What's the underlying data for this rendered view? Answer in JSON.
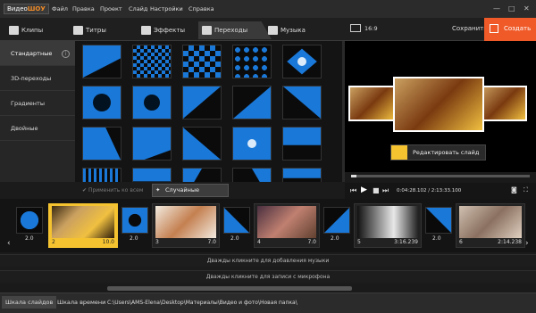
{
  "app": {
    "logo_prefix": "Видео",
    "logo_suffix": "ШОУ"
  },
  "menu": [
    "Файл",
    "Правка",
    "Проект",
    "Слайд",
    "Настройки",
    "Справка"
  ],
  "window_controls": [
    "—",
    "□",
    "✕"
  ],
  "tabs": [
    {
      "label": "Клипы",
      "icon": "clips-icon"
    },
    {
      "label": "Титры",
      "icon": "titles-icon"
    },
    {
      "label": "Эффекты",
      "icon": "effects-icon"
    },
    {
      "label": "Переходы",
      "icon": "transitions-icon",
      "active": true
    },
    {
      "label": "Музыка",
      "icon": "music-icon"
    }
  ],
  "categories": [
    {
      "label": "Стандартные",
      "active": true
    },
    {
      "label": "3D-переходы"
    },
    {
      "label": "Градиенты"
    },
    {
      "label": "Двойные"
    }
  ],
  "preview": {
    "aspect": "16:9",
    "save_label": "Сохранить",
    "create_label": "Создать",
    "edit_slide_label": "Редактировать слайд",
    "time": "0:04:28.102 / 2:13:33.100"
  },
  "actions": {
    "apply_all": "Применить ко всем",
    "random": "Случайные переходы"
  },
  "timeline": {
    "slides": [
      {
        "num": "2",
        "dur": "10.0"
      },
      {
        "num": "3",
        "dur": "7.0"
      },
      {
        "num": "4",
        "dur": "7.0"
      },
      {
        "num": "5",
        "dur": "3:16.239"
      },
      {
        "num": "6",
        "dur": "2:14.238"
      }
    ],
    "transition_durations": [
      "2.0",
      "2.0",
      "2.0",
      "2.0",
      "2.0"
    ]
  },
  "tracks": {
    "music": "Дважды кликните для добавления музыки",
    "mic": "Дважды кликните для записи с микрофона"
  },
  "status": {
    "storyboard": "Шкала слайдов",
    "timeline": "Шкала времени",
    "path": "C:\\Users\\AMS-Elena\\Desktop\\Материалы\\Видео и фото\\Новая папка\\"
  },
  "colors": {
    "accent_orange": "#f05a28",
    "accent_yellow": "#f5c330",
    "transition_blue": "#1a78d8"
  }
}
